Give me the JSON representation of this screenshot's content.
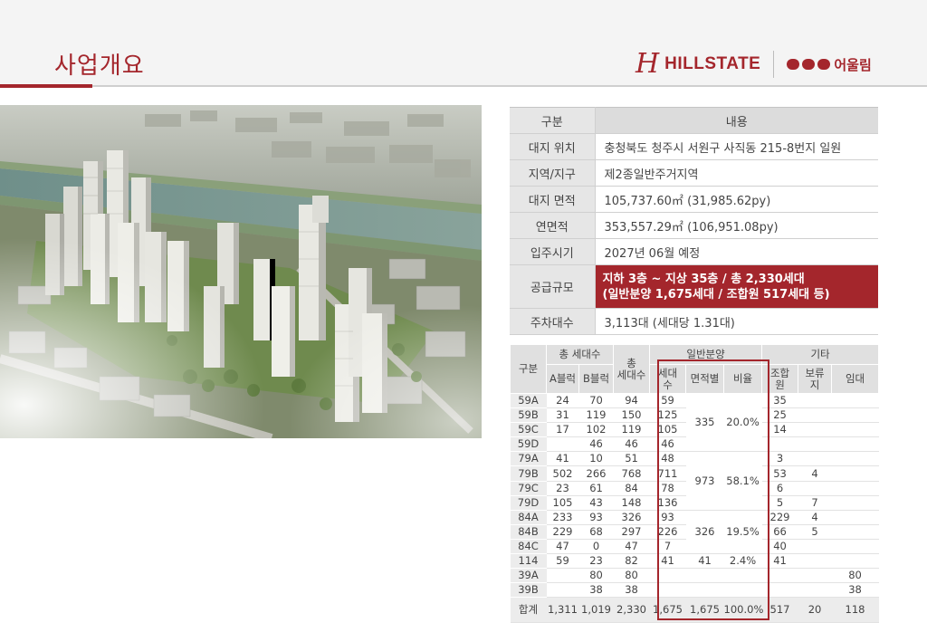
{
  "page": {
    "title": "사업개요"
  },
  "brand": {
    "name": "HILLSTATE",
    "partner": "어울림"
  },
  "overview": {
    "header": {
      "label": "구분",
      "value": "내용"
    },
    "rows": [
      {
        "label": "대지 위치",
        "value": "충청북도 청주시 서원구 사직동 215-8번지 일원"
      },
      {
        "label": "지역/지구",
        "value": "제2종일반주거지역"
      },
      {
        "label": "대지 면적",
        "value": "105,737.60㎡ (31,985.62py)"
      },
      {
        "label": "연면적",
        "value": "353,557.29㎡ (106,951.08py)"
      },
      {
        "label": "입주시기",
        "value": "2027년 06월 예정"
      }
    ],
    "supply": {
      "label": "공급규모",
      "line1": "지하 3층 ~ 지상 35층 / 총 2,330세대",
      "line2": "(일반분양 1,675세대 / 조합원 517세대 등)"
    },
    "parking": {
      "label": "주차대수",
      "value": "3,113대 (세대당 1.31대)"
    }
  },
  "units": {
    "header": {
      "category": "구분",
      "total_group": "총 세대수",
      "block_a": "A블럭",
      "block_b": "B블럭",
      "total_top": "총",
      "total_bottom": "세대수",
      "sale_group": "일반분양",
      "sale_units_top": "세대",
      "sale_units_bottom": "수",
      "sale_area": "면적별",
      "sale_ratio": "비율",
      "other_group": "기타",
      "member_top": "조합",
      "member_bottom": "원",
      "reserve_top": "보류",
      "reserve_bottom": "지",
      "rental": "임대"
    },
    "rows": [
      {
        "type": "59A",
        "a": "24",
        "b": "70",
        "total": "94",
        "sale": "59",
        "member": "35",
        "reserve": "",
        "rental": ""
      },
      {
        "type": "59B",
        "a": "31",
        "b": "119",
        "total": "150",
        "sale": "125",
        "member": "25",
        "reserve": "",
        "rental": ""
      },
      {
        "type": "59C",
        "a": "17",
        "b": "102",
        "total": "119",
        "sale": "105",
        "member": "14",
        "reserve": "",
        "rental": ""
      },
      {
        "type": "59D",
        "a": "",
        "b": "46",
        "total": "46",
        "sale": "46",
        "member": "",
        "reserve": "",
        "rental": ""
      },
      {
        "type": "79A",
        "a": "41",
        "b": "10",
        "total": "51",
        "sale": "48",
        "member": "3",
        "reserve": "",
        "rental": ""
      },
      {
        "type": "79B",
        "a": "502",
        "b": "266",
        "total": "768",
        "sale": "711",
        "member": "53",
        "reserve": "4",
        "rental": ""
      },
      {
        "type": "79C",
        "a": "23",
        "b": "61",
        "total": "84",
        "sale": "78",
        "member": "6",
        "reserve": "",
        "rental": ""
      },
      {
        "type": "79D",
        "a": "105",
        "b": "43",
        "total": "148",
        "sale": "136",
        "member": "5",
        "reserve": "7",
        "rental": ""
      },
      {
        "type": "84A",
        "a": "233",
        "b": "93",
        "total": "326",
        "sale": "93",
        "member": "229",
        "reserve": "4",
        "rental": ""
      },
      {
        "type": "84B",
        "a": "229",
        "b": "68",
        "total": "297",
        "sale": "226",
        "member": "66",
        "reserve": "5",
        "rental": ""
      },
      {
        "type": "84C",
        "a": "47",
        "b": "0",
        "total": "47",
        "sale": "7",
        "member": "40",
        "reserve": "",
        "rental": ""
      },
      {
        "type": "114",
        "a": "59",
        "b": "23",
        "total": "82",
        "sale": "41",
        "member": "41",
        "reserve": "",
        "rental": ""
      },
      {
        "type": "39A",
        "a": "",
        "b": "80",
        "total": "80",
        "sale": "",
        "member": "",
        "reserve": "",
        "rental": "80"
      },
      {
        "type": "39B",
        "a": "",
        "b": "38",
        "total": "38",
        "sale": "",
        "member": "",
        "reserve": "",
        "rental": "38"
      }
    ],
    "groups": [
      {
        "area": "335",
        "ratio": "20.0%"
      },
      {
        "area": "973",
        "ratio": "58.1%"
      },
      {
        "area": "326",
        "ratio": "19.5%"
      },
      {
        "area": "41",
        "ratio": "2.4%"
      }
    ],
    "totals": {
      "label": "합계",
      "a": "1,311",
      "b": "1,019",
      "total": "2,330",
      "sale": "1,675",
      "area": "1,675",
      "ratio": "100.0%",
      "member": "517",
      "reserve": "20",
      "rental": "118"
    }
  },
  "colors": {
    "accent": "#a4262c",
    "header_bg": "#f4f4f4",
    "label_bg": "#e6e6e6"
  }
}
